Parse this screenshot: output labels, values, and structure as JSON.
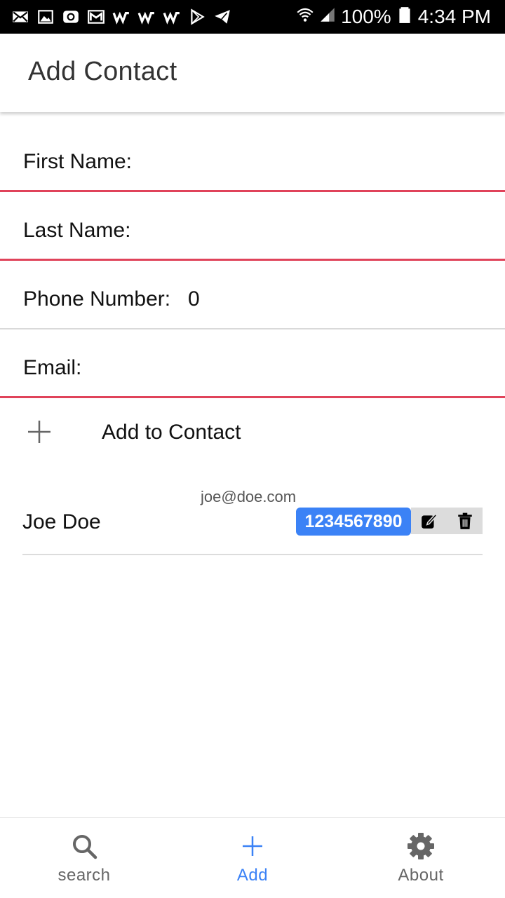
{
  "status_bar": {
    "battery": "100%",
    "time": "4:34 PM",
    "left_icons": [
      "mail-icon",
      "image-icon",
      "at-mail-icon",
      "gmail-icon",
      "w-app-icon",
      "w-app-icon",
      "w-app-icon",
      "play-store-icon",
      "telegram-icon"
    ],
    "right_icons": [
      "wifi-icon",
      "signal-icon",
      "battery-icon"
    ]
  },
  "appbar": {
    "title": "Add Contact"
  },
  "form": {
    "first_name": {
      "label": "First Name:",
      "value": ""
    },
    "last_name": {
      "label": "Last Name:",
      "value": ""
    },
    "phone": {
      "label": "Phone Number:",
      "value": "0"
    },
    "email": {
      "label": "Email:",
      "value": ""
    }
  },
  "add_button": {
    "label": "Add to Contact",
    "icon": "plus-icon"
  },
  "contacts": [
    {
      "name": "Joe Doe",
      "email": "joe@doe.com",
      "phone": "1234567890"
    }
  ],
  "bottom_nav": {
    "tabs": [
      {
        "label": "search",
        "icon": "search-icon",
        "active": false
      },
      {
        "label": "Add",
        "icon": "plus-icon",
        "active": true
      },
      {
        "label": "About",
        "icon": "gear-icon",
        "active": false
      }
    ]
  },
  "colors": {
    "accent": "#3b82f6",
    "error_underline": "#e0435a",
    "divider": "#d9d9d9",
    "status_bar": "#000000"
  }
}
